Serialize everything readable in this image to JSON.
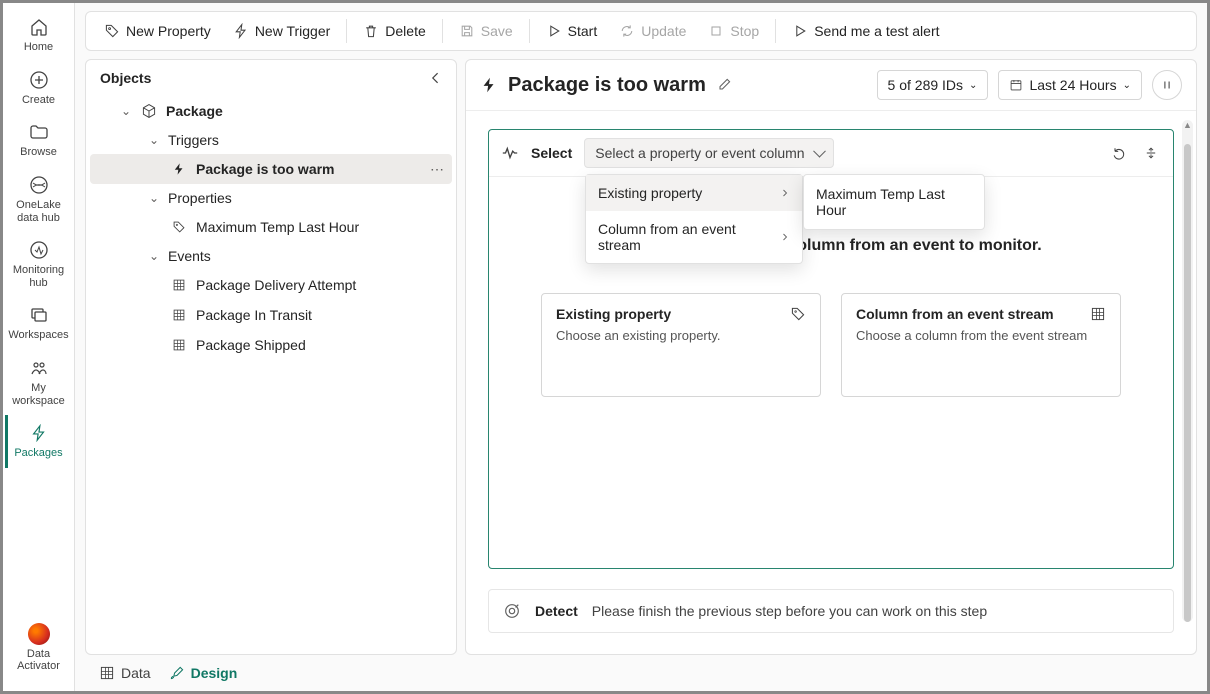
{
  "rail": {
    "items": [
      {
        "label": "Home",
        "icon": "home"
      },
      {
        "label": "Create",
        "icon": "plus-circle"
      },
      {
        "label": "Browse",
        "icon": "folder"
      },
      {
        "label": "OneLake data hub",
        "icon": "onelake"
      },
      {
        "label": "Monitoring hub",
        "icon": "monitor"
      },
      {
        "label": "Workspaces",
        "icon": "workspaces"
      },
      {
        "label": "My workspace",
        "icon": "my-workspace"
      },
      {
        "label": "Packages",
        "icon": "bolt"
      }
    ],
    "bottom_label": "Data Activator"
  },
  "toolbar": {
    "new_property": "New Property",
    "new_trigger": "New Trigger",
    "delete": "Delete",
    "save": "Save",
    "start": "Start",
    "update": "Update",
    "stop": "Stop",
    "send_alert": "Send me a test alert"
  },
  "objects": {
    "title": "Objects",
    "package": "Package",
    "triggers": "Triggers",
    "trigger_name": "Package is too warm",
    "properties": "Properties",
    "property_1": "Maximum Temp Last Hour",
    "events": "Events",
    "event_1": "Package Delivery Attempt",
    "event_2": "Package In Transit",
    "event_3": "Package Shipped"
  },
  "header": {
    "title": "Package is too warm",
    "ids": "5 of 289 IDs",
    "time": "Last 24 Hours"
  },
  "select": {
    "step_label": "Select",
    "dropdown_text": "Select a property or event column",
    "menu_existing": "Existing property",
    "menu_column": "Column from an event stream",
    "submenu_item": "Maximum Temp Last Hour",
    "prompt": "Select a property or a column from an event to monitor.",
    "card1_title": "Existing property",
    "card1_desc": "Choose an existing property.",
    "card2_title": "Column from an event stream",
    "card2_desc": "Choose a column from the event stream"
  },
  "detect": {
    "label": "Detect",
    "hint": "Please finish the previous step before you can work on this step"
  },
  "footer": {
    "data": "Data",
    "design": "Design"
  }
}
